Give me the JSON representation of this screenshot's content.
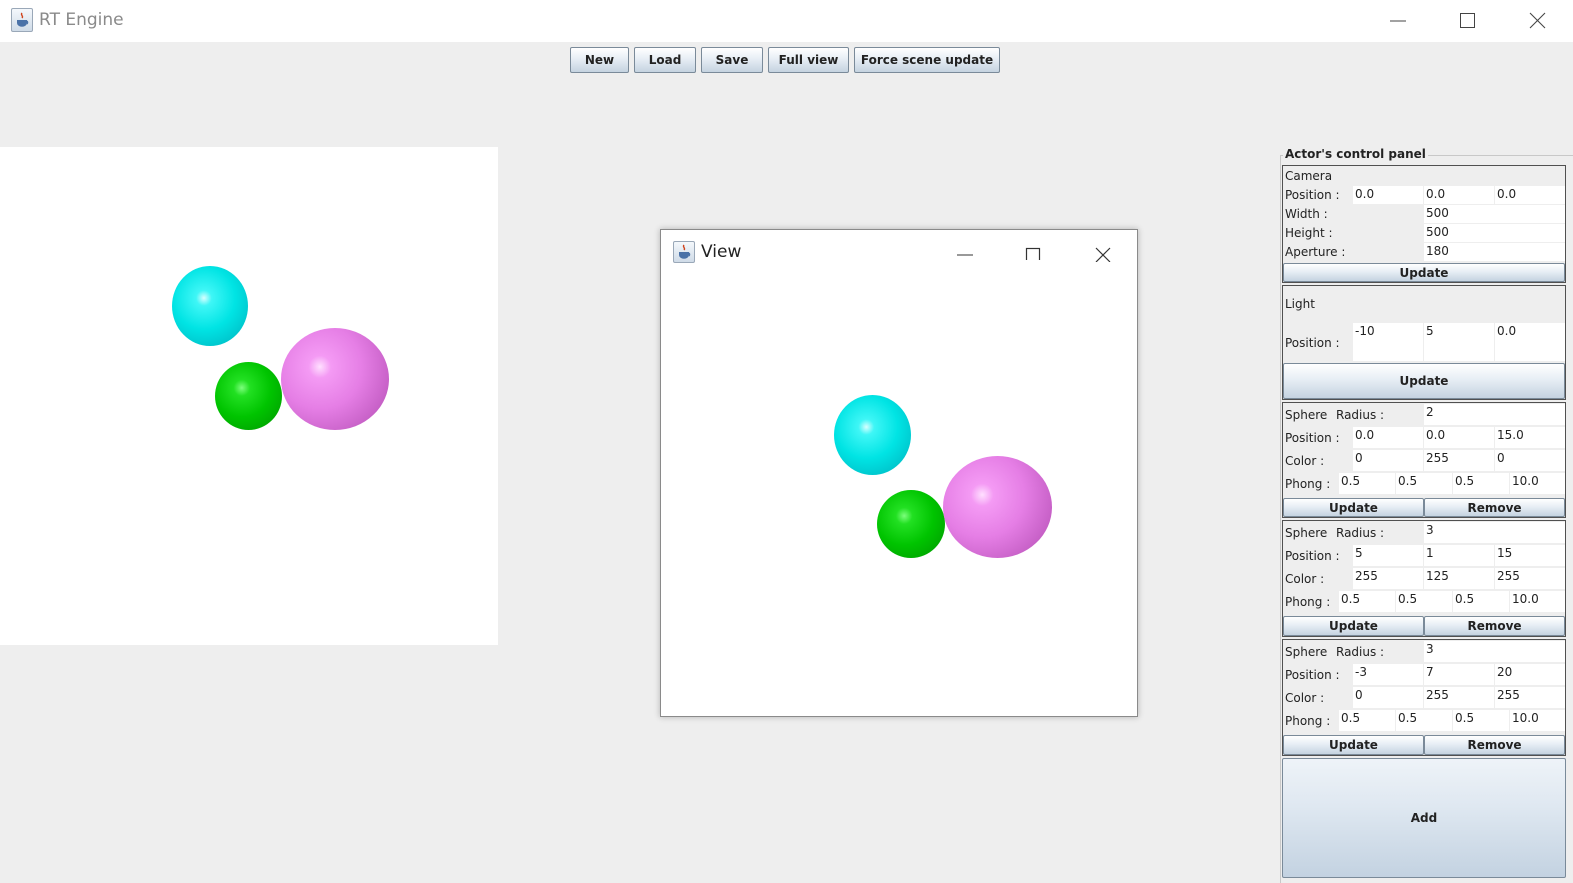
{
  "window": {
    "title": "RT Engine"
  },
  "toolbar": {
    "new_label": "New",
    "load_label": "Load",
    "save_label": "Save",
    "full_view_label": "Full view",
    "force_update_label": "Force scene update"
  },
  "view_window": {
    "title": "View"
  },
  "panel": {
    "title": "Actor's control panel",
    "camera": {
      "heading": "Camera",
      "position_label": "Position :",
      "position": [
        "0.0",
        "0.0",
        "0.0"
      ],
      "width_label": "Width :",
      "width": "500",
      "height_label": "Height :",
      "height": "500",
      "aperture_label": "Aperture :",
      "aperture": "180",
      "update_label": "Update"
    },
    "light": {
      "heading": "Light",
      "position_label": "Position :",
      "position": [
        "-10",
        "5",
        "0.0"
      ],
      "update_label": "Update"
    },
    "spheres": [
      {
        "heading": "Sphere",
        "radius_label": "Radius :",
        "radius": "2",
        "position_label": "Position :",
        "position": [
          "0.0",
          "0.0",
          "15.0"
        ],
        "color_label": "Color :",
        "color": [
          "0",
          "255",
          "0"
        ],
        "phong_label": "Phong :",
        "phong": [
          "0.5",
          "0.5",
          "0.5",
          "10.0"
        ],
        "update_label": "Update",
        "remove_label": "Remove"
      },
      {
        "heading": "Sphere",
        "radius_label": "Radius :",
        "radius": "3",
        "position_label": "Position :",
        "position": [
          "5",
          "1",
          "15"
        ],
        "color_label": "Color :",
        "color": [
          "255",
          "125",
          "255"
        ],
        "phong_label": "Phong :",
        "phong": [
          "0.5",
          "0.5",
          "0.5",
          "10.0"
        ],
        "update_label": "Update",
        "remove_label": "Remove"
      },
      {
        "heading": "Sphere",
        "radius_label": "Radius :",
        "radius": "3",
        "position_label": "Position :",
        "position": [
          "-3",
          "7",
          "20"
        ],
        "color_label": "Color :",
        "color": [
          "0",
          "255",
          "255"
        ],
        "phong_label": "Phong :",
        "phong": [
          "0.5",
          "0.5",
          "0.5",
          "10.0"
        ],
        "update_label": "Update",
        "remove_label": "Remove"
      }
    ],
    "add_label": "Add"
  },
  "scene_colors": {
    "cyan": "#00e4e4",
    "green": "#00c400",
    "pink": "#e57ee5"
  }
}
